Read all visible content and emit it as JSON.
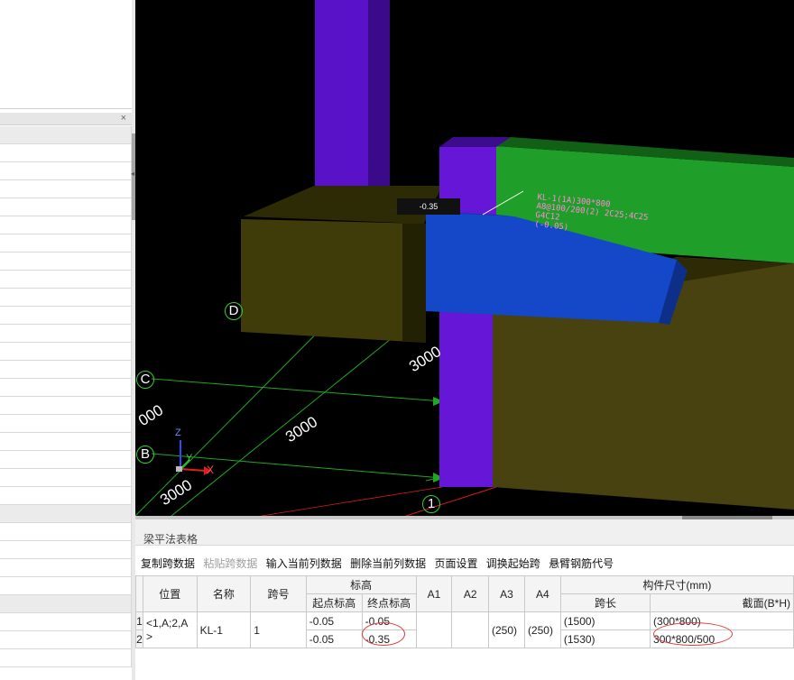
{
  "viewport": {
    "axes": {
      "z": "Z",
      "y": "Y",
      "x": "X"
    },
    "grid_bubbles": [
      "D",
      "C",
      "B",
      "1"
    ],
    "dimensions": [
      "3000",
      "3000",
      "3000",
      "000"
    ],
    "beam_annotation_lines": [
      "KL-1(1A)300*800",
      "A8@100/200(2) 2C25;4C25",
      "G4C12",
      "(-0.05)"
    ],
    "elevation_tag": "-0.35"
  },
  "bottom_panel": {
    "title": "梁平法表格",
    "toolbar": {
      "copy_span": "复制跨数据",
      "paste_span": "粘贴跨数据",
      "input_column": "输入当前列数据",
      "delete_column": "删除当前列数据",
      "page_setup": "页面设置",
      "swap_start": "调换起始跨",
      "cantilever_code": "悬臂钢筋代号"
    },
    "table": {
      "headers": {
        "position": "位置",
        "name": "名称",
        "span_no": "跨号",
        "elevation": "标高",
        "start_elev": "起点标高",
        "end_elev": "终点标高",
        "a1": "A1",
        "a2": "A2",
        "a3": "A3",
        "a4": "A4",
        "member_size": "构件尺寸(mm)",
        "span_len": "跨长",
        "section": "截面(B*H)"
      },
      "merged": {
        "position": "<1,A;2,A>",
        "name": "KL-1",
        "span": "1",
        "a3": "(250)",
        "a4": "(250)"
      },
      "rows": [
        {
          "num": "1",
          "start": "-0.05",
          "end": "-0.05",
          "span_len": "(1500)",
          "section": "(300*800)"
        },
        {
          "num": "2",
          "start": "-0.05",
          "end": "-0.35",
          "span_len": "(1530)",
          "section": "300*800/500"
        }
      ]
    }
  }
}
